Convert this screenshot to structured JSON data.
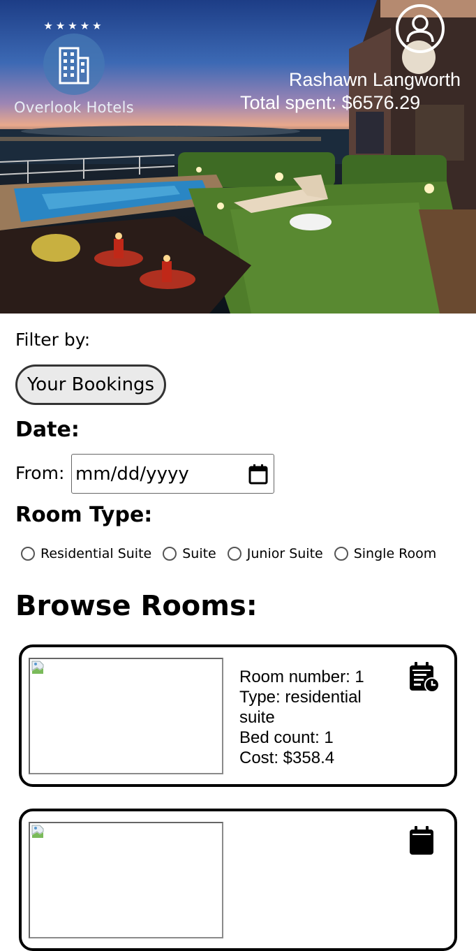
{
  "header": {
    "logo_stars": "★★★★★",
    "logo_text": "Overlook Hotels",
    "user_name": "Rashawn Langworth",
    "total_spent": "Total spent: $6576.29",
    "icons": {
      "logo": "hotel-building-icon",
      "account": "user-account-icon"
    }
  },
  "filters": {
    "filter_label": "Filter by:",
    "bookings_button": "Your Bookings",
    "date_heading": "Date:",
    "from_label": "From:",
    "from_placeholder": "mm/dd/yyyy",
    "room_type_heading": "Room Type:",
    "room_types": [
      "Residential Suite",
      "Suite",
      "Junior Suite",
      "Single Room"
    ]
  },
  "browse": {
    "heading": "Browse Rooms:",
    "rooms": [
      {
        "number": "Room number: 1",
        "type": "Type: residential suite",
        "beds": "Bed count: 1",
        "cost": "Cost: $358.4"
      },
      {
        "number": "",
        "type": "",
        "beds": "",
        "cost": ""
      }
    ]
  },
  "colors": {
    "card_border": "#000000",
    "button_bg": "#eaeaea",
    "logo_circle": "#4678b4"
  }
}
